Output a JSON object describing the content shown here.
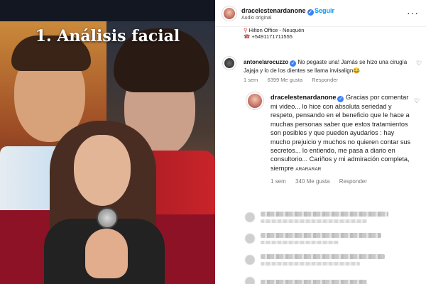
{
  "media": {
    "overlay_title": "1. Análisis facial"
  },
  "post_header": {
    "username": "dracelestenardanone",
    "verified": "✓",
    "separator": "•",
    "follow_label": "Seguir",
    "audio_label": "Audio original",
    "more_label": "···"
  },
  "caption": {
    "location_line": "Hilton Office - Neuquén",
    "phone_line": "+5491171711555",
    "location_icon": "pin-icon",
    "phone_icon": "phone-icon"
  },
  "comments": [
    {
      "username": "antonelarocuzzo",
      "verified": "✓",
      "text": "No pegaste una! Jamás se hizo una cirugía Jajaja y lo de los dientes se llama invisalign😂",
      "time": "1 sem",
      "likes": "6399 Me gusta",
      "reply_label": "Responder"
    },
    {
      "username": "dracelestenardanone",
      "verified": "✓",
      "text": "Gracias por comentar mi video... lo hice con absoluta seriedad y respeto, pensando en el beneficio que le hace a muchas personas saber que estos tratamientos son posibles y que pueden ayudarlos : hay mucho prejuicio y muchos no quieren contar sus secretos... lo entiendo, me pasa a diario en consultorio... Cariños y mi admiración completa, siempre",
      "text_tail": "ARARARAR",
      "time": "1 sem",
      "likes": "340 Me gusta",
      "reply_label": "Responder"
    }
  ],
  "colors": {
    "verified": "#3b82f6",
    "follow": "#0095f6",
    "red_band": "#8d1225"
  }
}
